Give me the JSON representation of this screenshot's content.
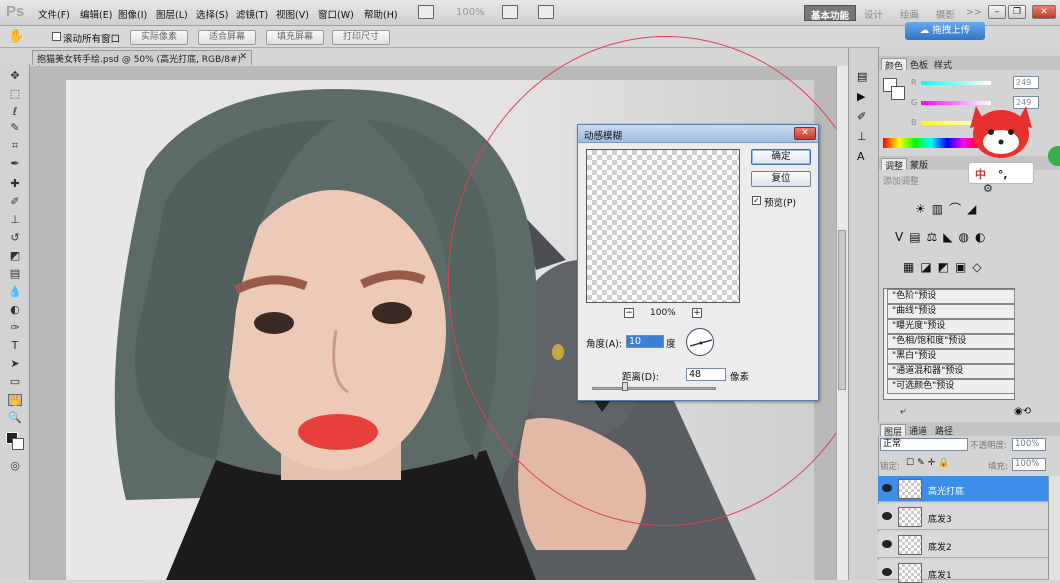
{
  "app": {
    "logo": "Ps",
    "zoom": "100%"
  },
  "menu": [
    "文件(F)",
    "编辑(E)",
    "图像(I)",
    "图层(L)",
    "选择(S)",
    "滤镜(T)",
    "视图(V)",
    "窗口(W)",
    "帮助(H)"
  ],
  "workspaces": [
    "基本功能",
    "设计",
    "绘画",
    "摄影",
    ">>"
  ],
  "options": {
    "scroll_all": "滚动所有窗口",
    "buttons": [
      "实际像素",
      "适合屏幕",
      "填充屏幕",
      "打印尺寸"
    ]
  },
  "upload_button": "拖拽上传",
  "doc_tab": "抱猫美女转手绘.psd @ 50% (高光打底, RGB/8#) *",
  "dialog": {
    "title": "动感模糊",
    "ok": "确定",
    "reset": "复位",
    "preview_label": "预览(P)",
    "zoom_percent": "100%",
    "angle_label": "角度(A):",
    "angle_value": "10",
    "angle_unit": "度",
    "distance_label": "距离(D):",
    "distance_value": "48",
    "distance_unit": "像素"
  },
  "color_panel": {
    "tabs": [
      "颜色",
      "色板",
      "样式"
    ],
    "channels": [
      {
        "label": "R",
        "value": "249"
      },
      {
        "label": "G",
        "value": "249"
      },
      {
        "label": "B",
        "value": ""
      }
    ]
  },
  "adjust_panel": {
    "tabs": [
      "调整",
      "蒙版"
    ],
    "subtitle": "添加调整",
    "presets": [
      "\"色阶\"预设",
      "\"曲线\"预设",
      "\"曝光度\"预设",
      "\"色相/饱和度\"预设",
      "\"黑白\"预设",
      "\"通道混和器\"预设",
      "\"可选颜色\"预设"
    ]
  },
  "layers_panel": {
    "tabs": [
      "图层",
      "通道",
      "路径"
    ],
    "blend_mode": "正常",
    "opacity_label": "不透明度:",
    "opacity_value": "100%",
    "lock_label": "锁定:",
    "fill_label": "填充:",
    "fill_value": "100%",
    "layers": [
      "高光打底",
      "底发3",
      "底发2",
      "底发1"
    ]
  },
  "mascot_text": [
    "中",
    "°,",
    "⚙"
  ],
  "colors": {
    "accent": "#3d8ee8",
    "annotation": "#e04050",
    "lip": "#e8413c"
  }
}
